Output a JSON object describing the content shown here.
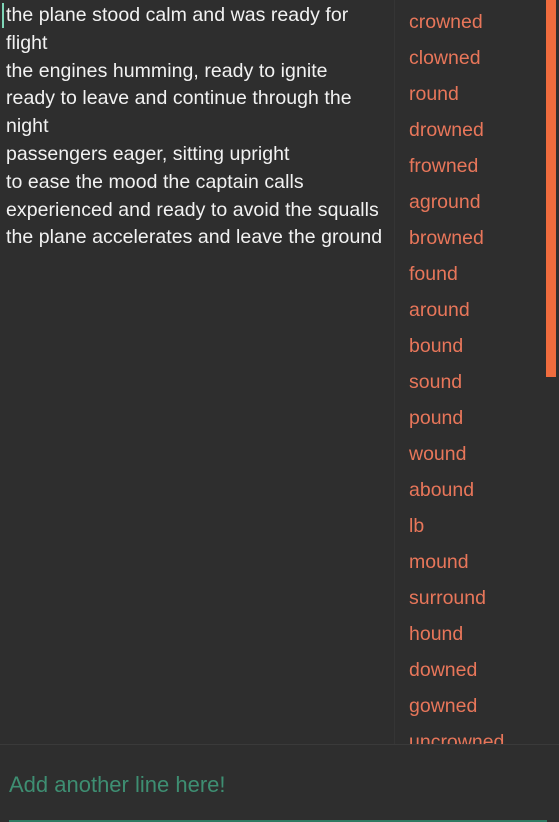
{
  "app": {
    "background_color": "#2e2e2e"
  },
  "editor": {
    "text_color": "#f2f2f2",
    "caret_color": "#7fd6b8",
    "lines": [
      "the plane stood calm and was ready for flight",
      "the engines humming, ready to ignite",
      "ready to leave and continue through the night",
      "passengers eager, sitting upright",
      "to ease the mood the captain calls",
      "experienced and ready to avoid the squalls",
      "the plane accelerates and leave the ground"
    ]
  },
  "rhymes": {
    "text_color": "#e8765a",
    "scrollbar_color": "#ef6c3e",
    "items": [
      "crowned",
      "clowned",
      "round",
      "drowned",
      "frowned",
      "aground",
      "browned",
      "found",
      "around",
      "bound",
      "sound",
      "pound",
      "wound",
      "abound",
      "lb",
      "mound",
      "surround",
      "hound",
      "downed",
      "gowned",
      "uncrowned"
    ]
  },
  "input_bar": {
    "placeholder": "Add another line here!",
    "value": "",
    "text_color": "#3e8e72",
    "underline_color": "#2f7a62"
  }
}
